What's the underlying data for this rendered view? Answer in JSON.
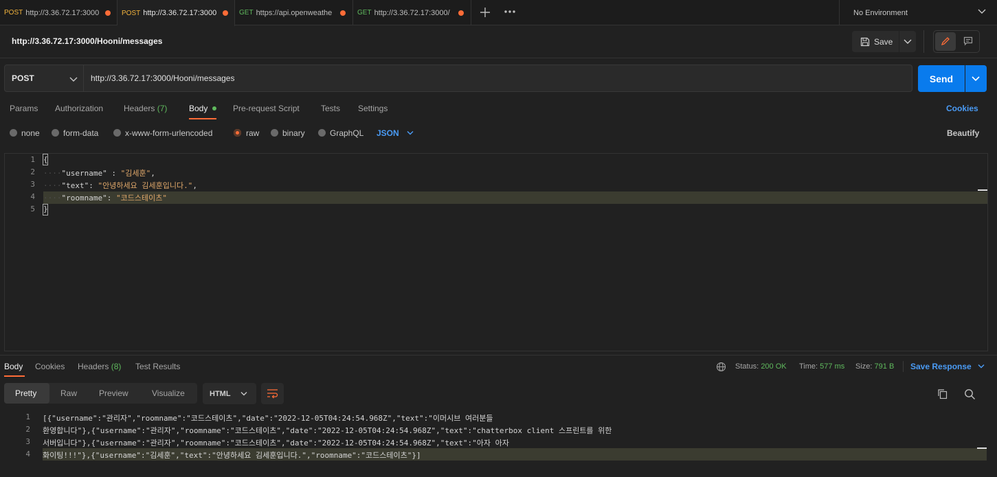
{
  "tabs": [
    {
      "method": "POST",
      "url": "http://3.36.72.17:3000"
    },
    {
      "method": "POST",
      "url": "http://3.36.72.17:3000"
    },
    {
      "method": "GET",
      "url": "https://api.openweathe"
    },
    {
      "method": "GET",
      "url": "http://3.36.72.17:3000/"
    }
  ],
  "environment": "No Environment",
  "request": {
    "title": "http://3.36.72.17:3000/Hooni/messages",
    "save_label": "Save",
    "method": "POST",
    "url": "http://3.36.72.17:3000/Hooni/messages",
    "send_label": "Send"
  },
  "req_tabs": {
    "params": "Params",
    "authorization": "Authorization",
    "headers": "Headers",
    "headers_count": "(7)",
    "body": "Body",
    "prerequest": "Pre-request Script",
    "tests": "Tests",
    "settings": "Settings",
    "cookies": "Cookies"
  },
  "body_types": {
    "none": "none",
    "form_data": "form-data",
    "urlencoded": "x-www-form-urlencoded",
    "raw": "raw",
    "binary": "binary",
    "graphql": "GraphQL",
    "format": "JSON",
    "beautify": "Beautify"
  },
  "editor": {
    "line_numbers": [
      "1",
      "2",
      "3",
      "4",
      "5"
    ],
    "open_brace": "{",
    "close_brace": "}",
    "l2_key": "\"username\"",
    "l2_sep": " : ",
    "l2_val": "\"김세훈\"",
    "l2_end": ",",
    "l3_key": "\"text\"",
    "l3_sep": ": ",
    "l3_val": "\"안녕하세요 김세훈입니다.\"",
    "l3_end": ",",
    "l4_key": "\"roomname\"",
    "l4_sep": ": ",
    "l4_val": "\"코드스테이츠\""
  },
  "response": {
    "tabs": {
      "body": "Body",
      "cookies": "Cookies",
      "headers": "Headers",
      "headers_count": "(8)",
      "test_results": "Test Results"
    },
    "status_label": "Status:",
    "status_value": "200 OK",
    "time_label": "Time:",
    "time_value": "577 ms",
    "size_label": "Size:",
    "size_value": "791 B",
    "save_response": "Save Response",
    "formats": {
      "pretty": "Pretty",
      "raw": "Raw",
      "preview": "Preview",
      "visualize": "Visualize"
    },
    "language": "HTML",
    "line_numbers": [
      "1",
      "2",
      "3",
      "4"
    ],
    "lines": [
      "[{\"username\":\"관리자\",\"roomname\":\"코드스테이츠\",\"date\":\"2022-12-05T04:24:54.968Z\",\"text\":\"이머시브 여러분들",
      "환영합니다\"},{\"username\":\"관리자\",\"roomname\":\"코드스테이츠\",\"date\":\"2022-12-05T04:24:54.968Z\",\"text\":\"chatterbox client 스프린트를 위한",
      "서버입니다\"},{\"username\":\"관리자\",\"roomname\":\"코드스테이츠\",\"date\":\"2022-12-05T04:24:54.968Z\",\"text\":\"아자 아자",
      "화이팅!!!\"},{\"username\":\"김세훈\",\"text\":\"안녕하세요 김세훈입니다.\",\"roomname\":\"코드스테이츠\"}]"
    ]
  },
  "icons": [
    "plus-icon",
    "more-icon",
    "chevron-down-icon",
    "save-icon",
    "pencil-icon",
    "comment-icon",
    "globe-icon",
    "wrap-icon",
    "copy-icon",
    "search-icon"
  ],
  "colors": {
    "accent": "#ff6c37",
    "send": "#097bed",
    "link": "#4a9bf5",
    "ok": "#5fb95d",
    "post": "#f2b33c"
  }
}
